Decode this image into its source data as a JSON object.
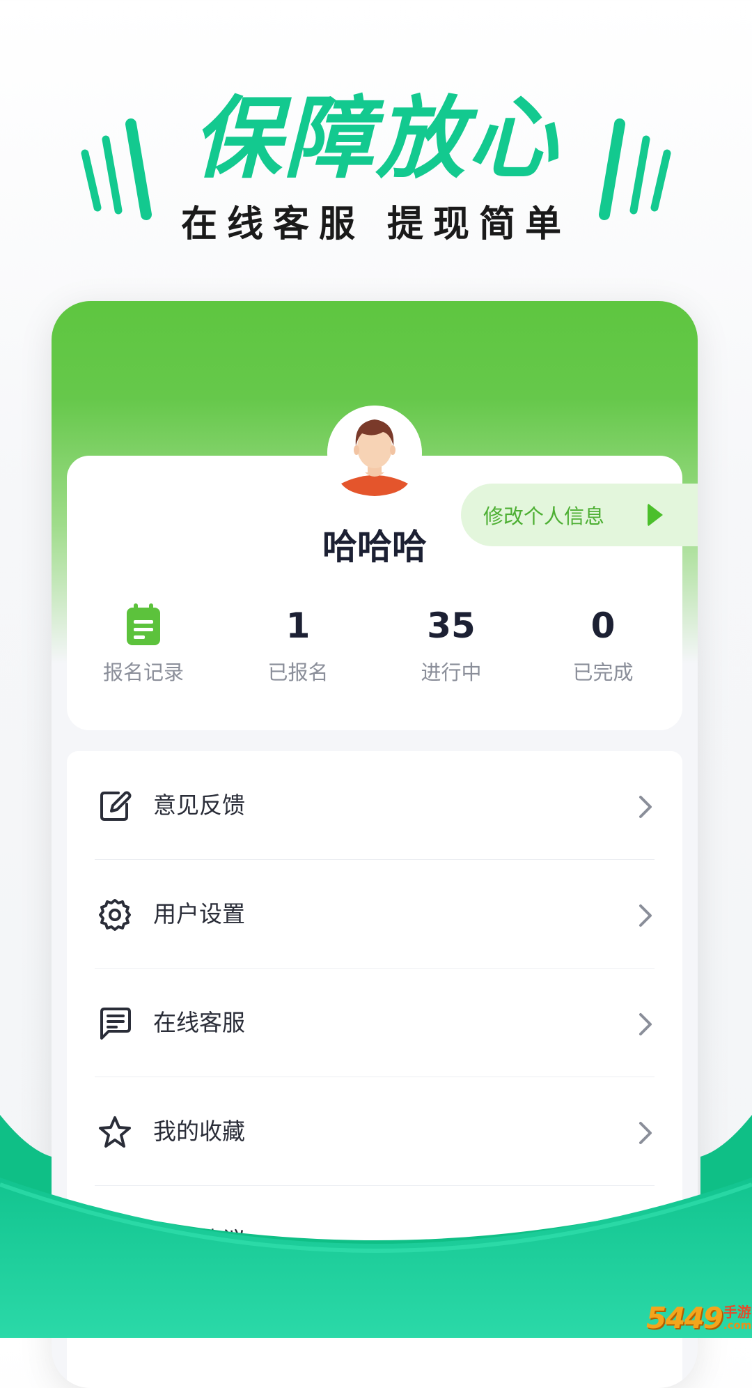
{
  "promo": {
    "title": "保障放心",
    "subtitle": "在线客服 提现简单",
    "accent_color": "#13c98f"
  },
  "profile": {
    "avatar_icon": "user-avatar-icon",
    "username": "哈哈哈",
    "edit_label": "修改个人信息",
    "edit_icon": "play-arrow-icon",
    "header_color": "#5ec640"
  },
  "stats": {
    "records": {
      "icon": "clipboard-icon",
      "label": "报名记录"
    },
    "registered": {
      "value": "1",
      "label": "已报名"
    },
    "in_progress": {
      "value": "35",
      "label": "进行中"
    },
    "completed": {
      "value": "0",
      "label": "已完成"
    }
  },
  "menu": {
    "items": [
      {
        "label": "意见反馈",
        "icon": "edit-icon"
      },
      {
        "label": "用户设置",
        "icon": "gear-icon"
      },
      {
        "label": "在线客服",
        "icon": "chat-icon"
      },
      {
        "label": "我的收藏",
        "icon": "star-icon"
      },
      {
        "label": "用户协议",
        "icon": "compass-icon"
      }
    ],
    "chevron_icon": "chevron-right-icon"
  },
  "watermark": {
    "number": "5449",
    "chinese": "手游网",
    "domain": ".com.cn"
  }
}
